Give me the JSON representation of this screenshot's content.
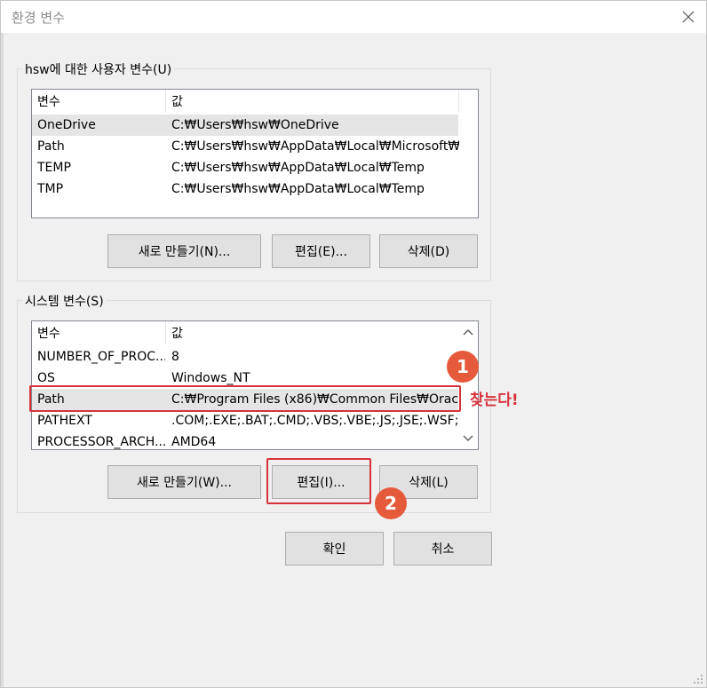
{
  "window": {
    "title": "환경 변수"
  },
  "user_vars": {
    "group_label": "hsw에 대한 사용자 변수(U)",
    "columns": [
      "변수",
      "값"
    ],
    "rows": [
      {
        "name": "OneDrive",
        "value": "C:₩Users₩hsw₩OneDrive"
      },
      {
        "name": "Path",
        "value": "C:₩Users₩hsw₩AppData₩Local₩Microsoft₩..."
      },
      {
        "name": "TEMP",
        "value": "C:₩Users₩hsw₩AppData₩Local₩Temp"
      },
      {
        "name": "TMP",
        "value": "C:₩Users₩hsw₩AppData₩Local₩Temp"
      }
    ],
    "buttons": {
      "new": "새로 만들기(N)...",
      "edit": "편집(E)...",
      "delete": "삭제(D)"
    }
  },
  "system_vars": {
    "group_label": "시스템 변수(S)",
    "columns": [
      "변수",
      "값"
    ],
    "rows": [
      {
        "name": "NUMBER_OF_PROC...",
        "value": "8"
      },
      {
        "name": "OS",
        "value": "Windows_NT"
      },
      {
        "name": "Path",
        "value": "C:₩Program Files (x86)₩Common Files₩Orac..."
      },
      {
        "name": "PATHEXT",
        "value": ".COM;.EXE;.BAT;.CMD;.VBS;.VBE;.JS;.JSE;.WSF;...."
      },
      {
        "name": "PROCESSOR_ARCH...",
        "value": "AMD64"
      }
    ],
    "buttons": {
      "new": "새로 만들기(W)...",
      "edit": "편집(I)...",
      "delete": "삭제(L)"
    }
  },
  "footer": {
    "ok": "확인",
    "cancel": "취소"
  },
  "annotations": {
    "step1": "1",
    "step2": "2",
    "find_note": "찾는다!"
  },
  "colors": {
    "annotation": "#d8323c",
    "badge": "#e65a3c",
    "selected_row": "#e5e5e5"
  },
  "icons": {
    "close": "close-icon",
    "scroll_up": "chevron-up-icon",
    "scroll_down": "chevron-down-icon"
  }
}
